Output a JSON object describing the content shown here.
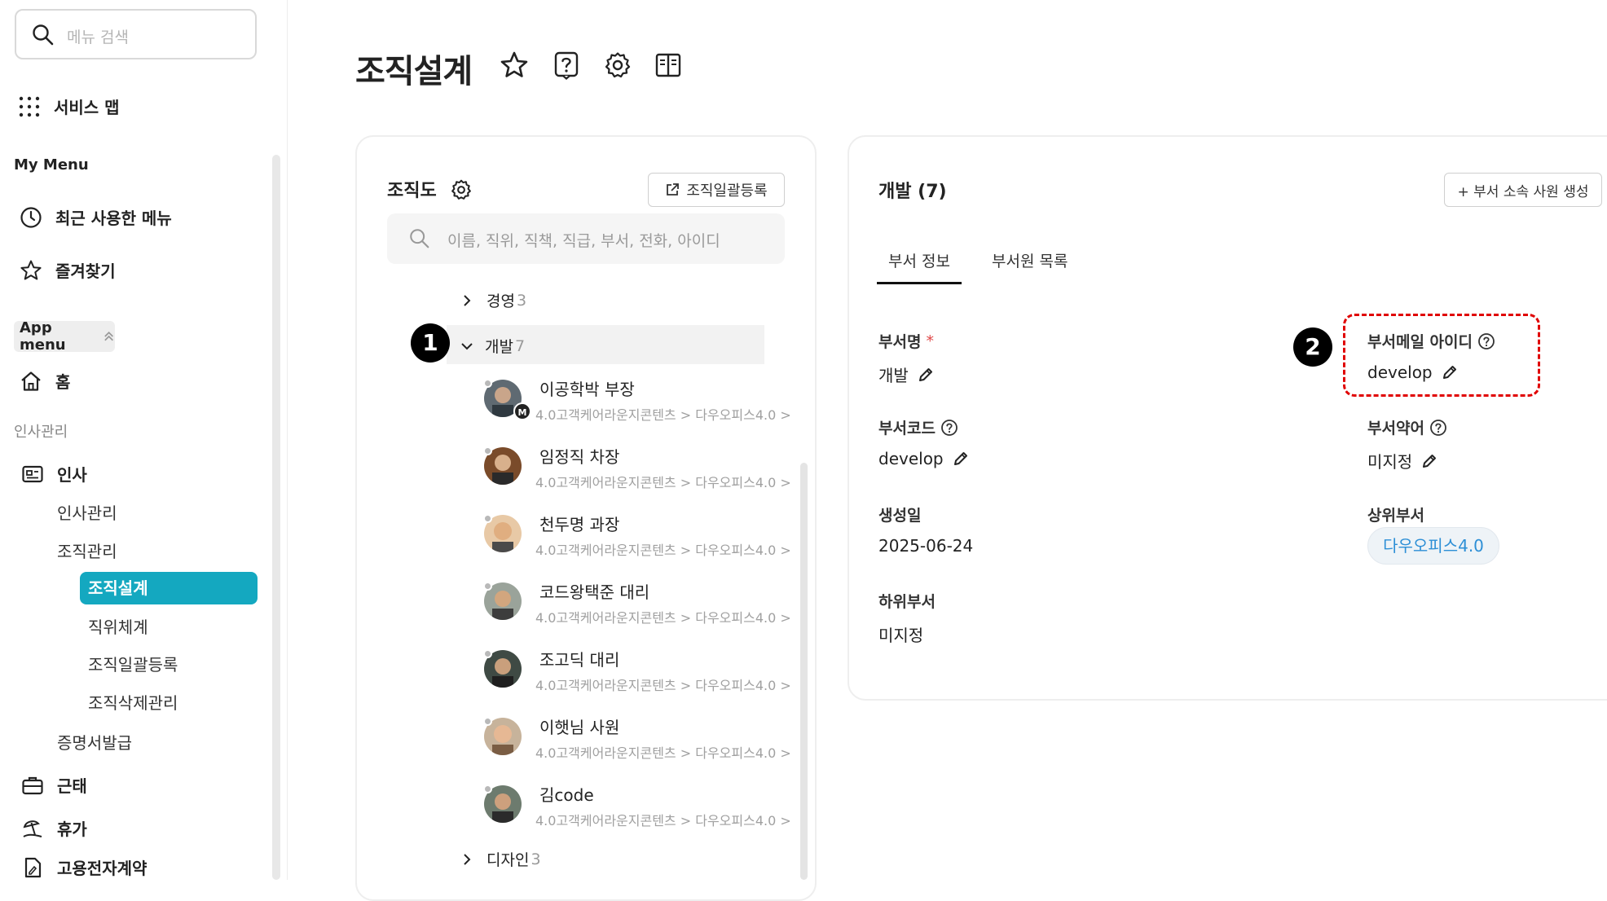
{
  "sidebar": {
    "search_placeholder": "메뉴 검색",
    "service_map": "서비스 맵",
    "my_menu": "My Menu",
    "recent": "최근 사용한 메뉴",
    "favorites": "즐겨찾기",
    "app_menu": "App menu",
    "home": "홈",
    "hr_mgmt_caption": "인사관리",
    "hr": "인사",
    "hr_sub": [
      "인사관리",
      "조직관리"
    ],
    "org_sub": [
      "조직설계",
      "직위체계",
      "조직일괄등록",
      "조직삭제관리"
    ],
    "certificate": "증명서발급",
    "attendance": "근태",
    "vacation": "휴가",
    "contract": "고용전자계약"
  },
  "page": {
    "title": "조직설계"
  },
  "org": {
    "title": "조직도",
    "bulk_button": "조직일괄등록",
    "search_placeholder": "이름, 직위, 직책, 직급, 부서, 전화, 아이디",
    "tree": [
      {
        "name": "경영",
        "count": "3"
      },
      {
        "name": "개발",
        "count": "7"
      },
      {
        "name": "디자인",
        "count": "3"
      }
    ],
    "employees": [
      {
        "name": "이공학박 부장",
        "path": "4.0고객케어라운지콘텐츠 > 다우오피스4.0 >",
        "manager_badge": "M"
      },
      {
        "name": "임정직 차장",
        "path": "4.0고객케어라운지콘텐츠 > 다우오피스4.0 >"
      },
      {
        "name": "천두명 과장",
        "path": "4.0고객케어라운지콘텐츠 > 다우오피스4.0 >"
      },
      {
        "name": "코드왕택준 대리",
        "path": "4.0고객케어라운지콘텐츠 > 다우오피스4.0 >"
      },
      {
        "name": "조고딕 대리",
        "path": "4.0고객케어라운지콘텐츠 > 다우오피스4.0 >"
      },
      {
        "name": "이햇님 사원",
        "path": "4.0고객케어라운지콘텐츠 > 다우오피스4.0 >"
      },
      {
        "name": "김code",
        "path": "4.0고객케어라운지콘텐츠 > 다우오피스4.0 >"
      }
    ]
  },
  "callouts": [
    "1",
    "2"
  ],
  "dept": {
    "title": "개발 (7)",
    "create_button": "+ 부서 소속 사원 생성",
    "tabs": [
      "부서 정보",
      "부서원 목록"
    ],
    "fields": {
      "name_label": "부서명",
      "required_mark": "*",
      "name_value": "개발",
      "mail_label": "부서메일 아이디",
      "mail_value": "develop",
      "code_label": "부서코드",
      "code_value": "develop",
      "abbr_label": "부서약어",
      "abbr_value": "미지정",
      "created_label": "생성일",
      "created_value": "2025-06-24",
      "parent_label": "상위부서",
      "parent_value": "다우오피스4.0",
      "child_label": "하위부서",
      "child_value": "미지정"
    }
  },
  "colors": {
    "accent": "#14a8c0",
    "link": "#2d8fd6",
    "callout_box": "#e00000"
  }
}
